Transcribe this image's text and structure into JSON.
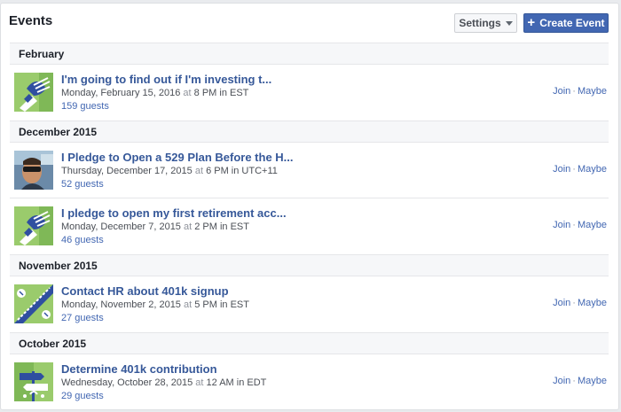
{
  "header": {
    "title": "Events",
    "settings_label": "Settings",
    "create_label": "Create Event",
    "create_icon": "plus-icon"
  },
  "sections": [
    {
      "label": "February",
      "events": [
        {
          "title": "I'm going to find out if I'm investing t...",
          "date": "Monday, February 15, 2016",
          "at": "at",
          "time": "8 PM in EST",
          "guests": "159 guests",
          "thumb": "handshake-thumbnail",
          "join": "Join",
          "sep": "·",
          "maybe": "Maybe"
        }
      ]
    },
    {
      "label": "December 2015",
      "events": [
        {
          "title": "I Pledge to Open a 529 Plan Before the H...",
          "date": "Thursday, December 17, 2015",
          "at": "at",
          "time": "6 PM in UTC+11",
          "guests": "52 guests",
          "thumb": "person-photo-thumbnail",
          "join": "Join",
          "sep": "·",
          "maybe": "Maybe"
        },
        {
          "title": "I pledge to open my first retirement acc...",
          "date": "Monday, December 7, 2015",
          "at": "at",
          "time": "2 PM in EST",
          "guests": "46 guests",
          "thumb": "handshake-thumbnail",
          "join": "Join",
          "sep": "·",
          "maybe": "Maybe"
        }
      ]
    },
    {
      "label": "November 2015",
      "events": [
        {
          "title": "Contact HR about 401k signup",
          "date": "Monday, November 2, 2015",
          "at": "at",
          "time": "5 PM in EST",
          "guests": "27 guests",
          "thumb": "zipper-thumbnail",
          "join": "Join",
          "sep": "·",
          "maybe": "Maybe"
        }
      ]
    },
    {
      "label": "October 2015",
      "events": [
        {
          "title": "Determine 401k contribution",
          "date": "Wednesday, October 28, 2015",
          "at": "at",
          "time": "12 AM in EDT",
          "guests": "29 guests",
          "thumb": "signpost-thumbnail",
          "join": "Join",
          "sep": "·",
          "maybe": "Maybe"
        }
      ]
    }
  ],
  "colors": {
    "link": "#365899",
    "button_primary": "#4267b2",
    "section_bg": "#f6f7f9",
    "thumb_green": "#9acb6c"
  }
}
